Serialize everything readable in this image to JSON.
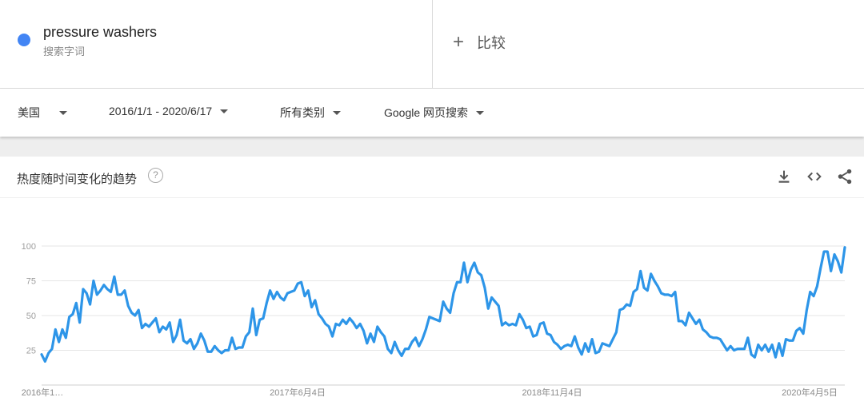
{
  "search_term": {
    "name": "pressure washers",
    "type_label": "搜索字词",
    "color": "#4285f4"
  },
  "compare": {
    "plus": "+",
    "label": "比较"
  },
  "filters": {
    "region": "美国",
    "date_range": "2016/1/1 - 2020/6/17",
    "category": "所有类别",
    "search_type": "Google 网页搜索"
  },
  "card": {
    "title": "热度随时间变化的趋势",
    "help": "?",
    "actions": [
      "download-icon",
      "embed-icon",
      "share-icon"
    ]
  },
  "chart_data": {
    "type": "line",
    "title": "",
    "xlabel": "",
    "ylabel": "",
    "ylim": [
      0,
      100
    ],
    "yticks": [
      25,
      50,
      75,
      100
    ],
    "x_tick_labels": [
      "2016年1…",
      "2017年6月4日",
      "2018年11月4日",
      "2020年4月5日"
    ],
    "grid": true,
    "line_color": "#2d95e8",
    "series": [
      {
        "values": [
          22,
          17,
          23,
          26,
          40,
          31,
          40,
          34,
          49,
          51,
          59,
          45,
          69,
          66,
          58,
          75,
          65,
          68,
          72,
          69,
          67,
          78,
          65,
          65,
          68,
          57,
          52,
          50,
          54,
          41,
          44,
          42,
          45,
          48,
          38,
          42,
          40,
          45,
          31,
          36,
          47,
          32,
          30,
          33,
          26,
          30,
          37,
          32,
          24,
          24,
          28,
          25,
          23,
          25,
          25,
          34,
          26,
          27,
          27,
          35,
          38,
          55,
          36,
          47,
          48,
          59,
          68,
          62,
          67,
          63,
          61,
          66,
          67,
          68,
          73,
          74,
          64,
          68,
          56,
          61,
          51,
          48,
          44,
          42,
          35,
          44,
          43,
          47,
          44,
          48,
          45,
          41,
          44,
          39,
          30,
          37,
          31,
          42,
          38,
          35,
          26,
          23,
          31,
          25,
          21,
          26,
          26,
          31,
          34,
          28,
          33,
          40,
          49,
          48,
          47,
          46,
          60,
          55,
          52,
          66,
          74,
          74,
          88,
          74,
          83,
          88,
          81,
          79,
          70,
          55,
          63,
          60,
          57,
          43,
          45,
          43,
          44,
          43,
          51,
          47,
          41,
          42,
          35,
          36,
          44,
          45,
          37,
          36,
          31,
          29,
          26,
          28,
          29,
          28,
          35,
          27,
          22,
          30,
          24,
          33,
          23,
          24,
          30,
          29,
          28,
          33,
          38,
          54,
          55,
          58,
          57,
          67,
          69,
          82,
          70,
          68,
          80,
          75,
          71,
          66,
          65,
          65,
          64,
          67,
          46,
          46,
          43,
          52,
          48,
          44,
          47,
          40,
          38,
          35,
          34,
          34,
          33,
          29,
          25,
          28,
          25,
          26,
          26,
          26,
          34,
          22,
          20,
          29,
          25,
          29,
          24,
          29,
          20,
          30,
          21,
          33,
          32,
          32,
          39,
          41,
          37,
          54,
          67,
          64,
          71,
          84,
          96,
          96,
          82,
          94,
          89,
          81,
          99
        ]
      }
    ]
  }
}
